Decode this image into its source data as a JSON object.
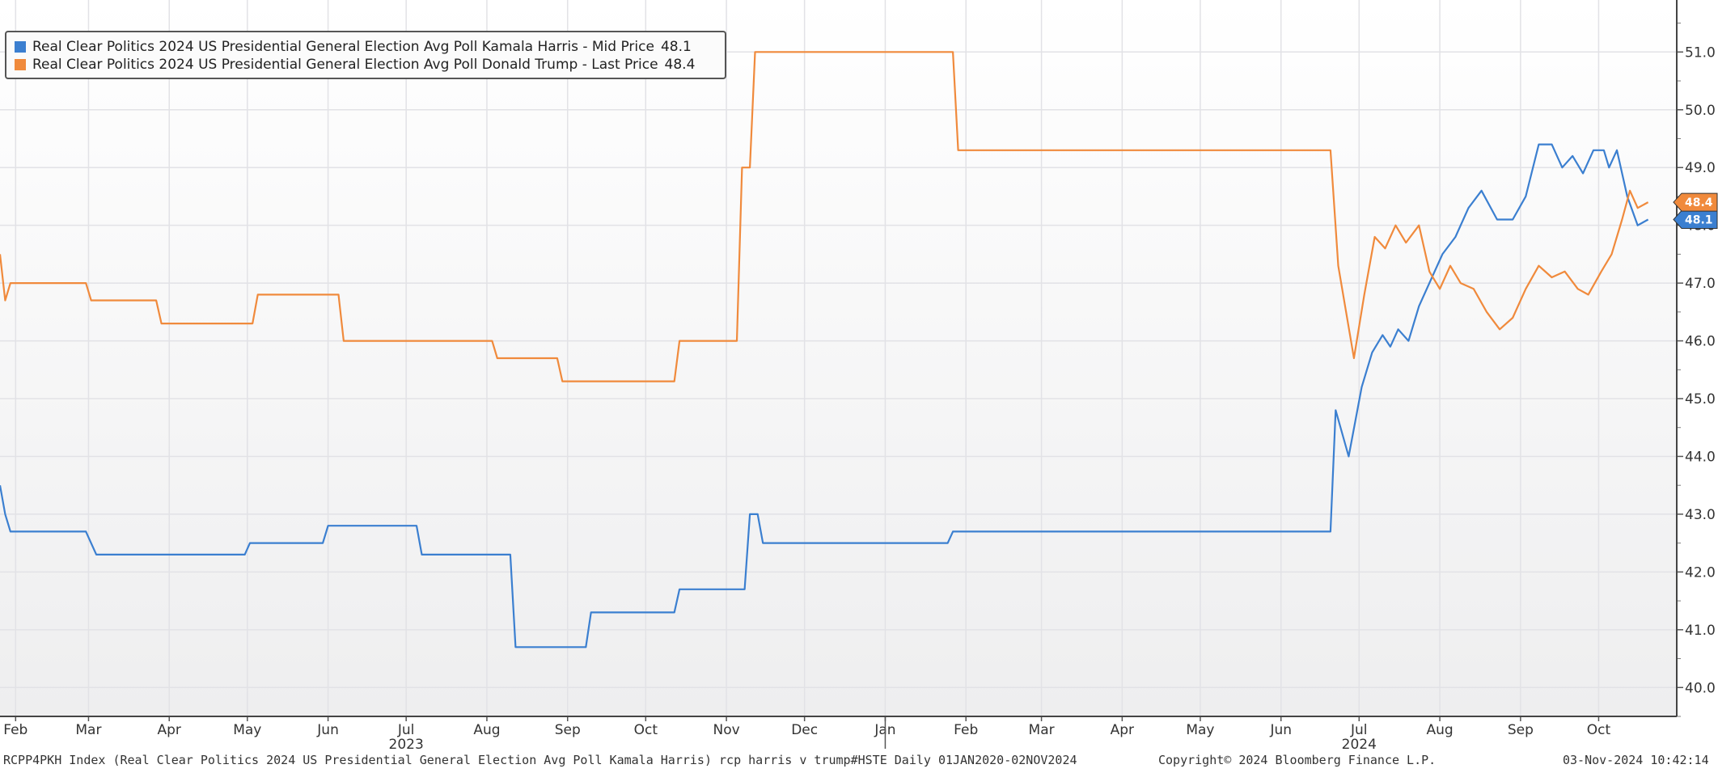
{
  "chart_data": {
    "type": "line",
    "title": "",
    "xlabel": "",
    "ylabel": "",
    "ylim": [
      39.5,
      51.9
    ],
    "x_range": [
      "2023-01-26",
      "2024-10-31"
    ],
    "grid": true,
    "legend_position": "top-left",
    "y_ticks": [
      "40.0",
      "41.0",
      "42.0",
      "43.0",
      "44.0",
      "45.0",
      "46.0",
      "47.0",
      "48.0",
      "49.0",
      "50.0",
      "51.0"
    ],
    "x_ticks": [
      {
        "label": "Feb",
        "date": "2023-02-01"
      },
      {
        "label": "Mar",
        "date": "2023-03-01"
      },
      {
        "label": "Apr",
        "date": "2023-04-01"
      },
      {
        "label": "May",
        "date": "2023-05-01"
      },
      {
        "label": "Jun",
        "date": "2023-06-01"
      },
      {
        "label": "Jul",
        "date": "2023-07-01"
      },
      {
        "label": "Aug",
        "date": "2023-08-01"
      },
      {
        "label": "Sep",
        "date": "2023-09-01"
      },
      {
        "label": "Oct",
        "date": "2023-10-01"
      },
      {
        "label": "Nov",
        "date": "2023-11-01"
      },
      {
        "label": "Dec",
        "date": "2023-12-01"
      },
      {
        "label": "Jan",
        "date": "2024-01-01"
      },
      {
        "label": "Feb",
        "date": "2024-02-01"
      },
      {
        "label": "Mar",
        "date": "2024-03-01"
      },
      {
        "label": "Apr",
        "date": "2024-04-01"
      },
      {
        "label": "May",
        "date": "2024-05-01"
      },
      {
        "label": "Jun",
        "date": "2024-06-01"
      },
      {
        "label": "Jul",
        "date": "2024-07-01"
      },
      {
        "label": "Aug",
        "date": "2024-08-01"
      },
      {
        "label": "Sep",
        "date": "2024-09-01"
      },
      {
        "label": "Oct",
        "date": "2024-10-01"
      }
    ],
    "year_labels": [
      {
        "label": "2023",
        "date": "2023-07-01"
      },
      {
        "label": "2024",
        "date": "2024-07-01"
      }
    ],
    "year_separator_date": "2024-01-01",
    "series": [
      {
        "name": "Real Clear Politics 2024 US Presidential General Election Avg Poll Kamala Harris - Mid Price",
        "legend_value": "48.1",
        "last_value": "48.1",
        "color": "#3b7fd0",
        "points": [
          [
            "2023-01-26",
            43.5
          ],
          [
            "2023-01-28",
            43.0
          ],
          [
            "2023-01-30",
            42.7
          ],
          [
            "2023-02-28",
            42.7
          ],
          [
            "2023-03-04",
            42.3
          ],
          [
            "2023-04-30",
            42.3
          ],
          [
            "2023-05-02",
            42.5
          ],
          [
            "2023-05-30",
            42.5
          ],
          [
            "2023-06-01",
            42.8
          ],
          [
            "2023-07-05",
            42.8
          ],
          [
            "2023-07-07",
            42.3
          ],
          [
            "2023-08-10",
            42.3
          ],
          [
            "2023-08-12",
            40.7
          ],
          [
            "2023-09-08",
            40.7
          ],
          [
            "2023-09-10",
            41.3
          ],
          [
            "2023-10-12",
            41.3
          ],
          [
            "2023-10-14",
            41.7
          ],
          [
            "2023-11-08",
            41.7
          ],
          [
            "2023-11-10",
            43.0
          ],
          [
            "2023-11-13",
            43.0
          ],
          [
            "2023-11-15",
            42.5
          ],
          [
            "2024-01-25",
            42.5
          ],
          [
            "2024-01-27",
            42.7
          ],
          [
            "2024-06-20",
            42.7
          ],
          [
            "2024-06-22",
            44.8
          ],
          [
            "2024-06-27",
            44.0
          ],
          [
            "2024-07-02",
            45.2
          ],
          [
            "2024-07-06",
            45.8
          ],
          [
            "2024-07-10",
            46.1
          ],
          [
            "2024-07-13",
            45.9
          ],
          [
            "2024-07-16",
            46.2
          ],
          [
            "2024-07-20",
            46.0
          ],
          [
            "2024-07-24",
            46.6
          ],
          [
            "2024-07-28",
            47.0
          ],
          [
            "2024-08-02",
            47.5
          ],
          [
            "2024-08-07",
            47.8
          ],
          [
            "2024-08-12",
            48.3
          ],
          [
            "2024-08-17",
            48.6
          ],
          [
            "2024-08-23",
            48.1
          ],
          [
            "2024-08-29",
            48.1
          ],
          [
            "2024-09-03",
            48.5
          ],
          [
            "2024-09-08",
            49.4
          ],
          [
            "2024-09-13",
            49.4
          ],
          [
            "2024-09-17",
            49.0
          ],
          [
            "2024-09-21",
            49.2
          ],
          [
            "2024-09-25",
            48.9
          ],
          [
            "2024-09-29",
            49.3
          ],
          [
            "2024-10-03",
            49.3
          ],
          [
            "2024-10-05",
            49.0
          ],
          [
            "2024-10-08",
            49.3
          ],
          [
            "2024-10-12",
            48.5
          ],
          [
            "2024-10-16",
            48.0
          ],
          [
            "2024-10-20",
            48.1
          ]
        ]
      },
      {
        "name": "Real Clear Politics 2024 US Presidential General Election Avg Poll Donald Trump - Last Price",
        "legend_value": "48.4",
        "last_value": "48.4",
        "color": "#f08a3c",
        "points": [
          [
            "2023-01-26",
            47.5
          ],
          [
            "2023-01-28",
            46.7
          ],
          [
            "2023-01-30",
            47.0
          ],
          [
            "2023-02-28",
            47.0
          ],
          [
            "2023-03-02",
            46.7
          ],
          [
            "2023-03-27",
            46.7
          ],
          [
            "2023-03-29",
            46.3
          ],
          [
            "2023-05-03",
            46.3
          ],
          [
            "2023-05-05",
            46.8
          ],
          [
            "2023-06-05",
            46.8
          ],
          [
            "2023-06-07",
            46.0
          ],
          [
            "2023-08-03",
            46.0
          ],
          [
            "2023-08-05",
            45.7
          ],
          [
            "2023-08-28",
            45.7
          ],
          [
            "2023-08-30",
            45.3
          ],
          [
            "2023-10-12",
            45.3
          ],
          [
            "2023-10-14",
            46.0
          ],
          [
            "2023-11-05",
            46.0
          ],
          [
            "2023-11-07",
            49.0
          ],
          [
            "2023-11-10",
            49.0
          ],
          [
            "2023-11-12",
            51.0
          ],
          [
            "2024-01-27",
            51.0
          ],
          [
            "2024-01-29",
            49.3
          ],
          [
            "2024-06-20",
            49.3
          ],
          [
            "2024-06-23",
            47.3
          ],
          [
            "2024-06-29",
            45.7
          ],
          [
            "2024-07-03",
            46.8
          ],
          [
            "2024-07-07",
            47.8
          ],
          [
            "2024-07-11",
            47.6
          ],
          [
            "2024-07-15",
            48.0
          ],
          [
            "2024-07-19",
            47.7
          ],
          [
            "2024-07-24",
            48.0
          ],
          [
            "2024-07-28",
            47.2
          ],
          [
            "2024-08-01",
            46.9
          ],
          [
            "2024-08-05",
            47.3
          ],
          [
            "2024-08-09",
            47.0
          ],
          [
            "2024-08-14",
            46.9
          ],
          [
            "2024-08-19",
            46.5
          ],
          [
            "2024-08-24",
            46.2
          ],
          [
            "2024-08-29",
            46.4
          ],
          [
            "2024-09-03",
            46.9
          ],
          [
            "2024-09-08",
            47.3
          ],
          [
            "2024-09-13",
            47.1
          ],
          [
            "2024-09-18",
            47.2
          ],
          [
            "2024-09-23",
            46.9
          ],
          [
            "2024-09-27",
            46.8
          ],
          [
            "2024-10-02",
            47.2
          ],
          [
            "2024-10-06",
            47.5
          ],
          [
            "2024-10-10",
            48.1
          ],
          [
            "2024-10-13",
            48.6
          ],
          [
            "2024-10-16",
            48.3
          ],
          [
            "2024-10-20",
            48.4
          ]
        ]
      }
    ]
  },
  "footer": {
    "left": "RCPP4PKH Index (Real Clear Politics 2024 US Presidential General Election Avg Poll Kamala Harris) rcp harris v trump#HSTE  Daily 01JAN2020-02NOV2024",
    "center": "Copyright© 2024 Bloomberg Finance L.P.",
    "right": "03-Nov-2024 10:42:14"
  }
}
